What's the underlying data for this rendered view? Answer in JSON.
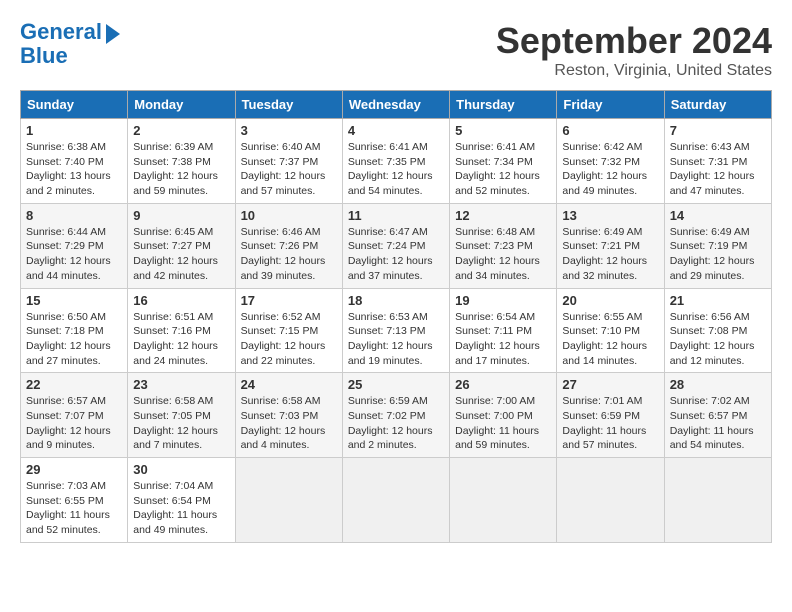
{
  "header": {
    "logo_line1": "General",
    "logo_line2": "Blue",
    "title": "September 2024",
    "subtitle": "Reston, Virginia, United States"
  },
  "weekdays": [
    "Sunday",
    "Monday",
    "Tuesday",
    "Wednesday",
    "Thursday",
    "Friday",
    "Saturday"
  ],
  "weeks": [
    [
      {
        "day": "1",
        "sunrise": "6:38 AM",
        "sunset": "7:40 PM",
        "daylight": "13 hours and 2 minutes."
      },
      {
        "day": "2",
        "sunrise": "6:39 AM",
        "sunset": "7:38 PM",
        "daylight": "12 hours and 59 minutes."
      },
      {
        "day": "3",
        "sunrise": "6:40 AM",
        "sunset": "7:37 PM",
        "daylight": "12 hours and 57 minutes."
      },
      {
        "day": "4",
        "sunrise": "6:41 AM",
        "sunset": "7:35 PM",
        "daylight": "12 hours and 54 minutes."
      },
      {
        "day": "5",
        "sunrise": "6:41 AM",
        "sunset": "7:34 PM",
        "daylight": "12 hours and 52 minutes."
      },
      {
        "day": "6",
        "sunrise": "6:42 AM",
        "sunset": "7:32 PM",
        "daylight": "12 hours and 49 minutes."
      },
      {
        "day": "7",
        "sunrise": "6:43 AM",
        "sunset": "7:31 PM",
        "daylight": "12 hours and 47 minutes."
      }
    ],
    [
      {
        "day": "8",
        "sunrise": "6:44 AM",
        "sunset": "7:29 PM",
        "daylight": "12 hours and 44 minutes."
      },
      {
        "day": "9",
        "sunrise": "6:45 AM",
        "sunset": "7:27 PM",
        "daylight": "12 hours and 42 minutes."
      },
      {
        "day": "10",
        "sunrise": "6:46 AM",
        "sunset": "7:26 PM",
        "daylight": "12 hours and 39 minutes."
      },
      {
        "day": "11",
        "sunrise": "6:47 AM",
        "sunset": "7:24 PM",
        "daylight": "12 hours and 37 minutes."
      },
      {
        "day": "12",
        "sunrise": "6:48 AM",
        "sunset": "7:23 PM",
        "daylight": "12 hours and 34 minutes."
      },
      {
        "day": "13",
        "sunrise": "6:49 AM",
        "sunset": "7:21 PM",
        "daylight": "12 hours and 32 minutes."
      },
      {
        "day": "14",
        "sunrise": "6:49 AM",
        "sunset": "7:19 PM",
        "daylight": "12 hours and 29 minutes."
      }
    ],
    [
      {
        "day": "15",
        "sunrise": "6:50 AM",
        "sunset": "7:18 PM",
        "daylight": "12 hours and 27 minutes."
      },
      {
        "day": "16",
        "sunrise": "6:51 AM",
        "sunset": "7:16 PM",
        "daylight": "12 hours and 24 minutes."
      },
      {
        "day": "17",
        "sunrise": "6:52 AM",
        "sunset": "7:15 PM",
        "daylight": "12 hours and 22 minutes."
      },
      {
        "day": "18",
        "sunrise": "6:53 AM",
        "sunset": "7:13 PM",
        "daylight": "12 hours and 19 minutes."
      },
      {
        "day": "19",
        "sunrise": "6:54 AM",
        "sunset": "7:11 PM",
        "daylight": "12 hours and 17 minutes."
      },
      {
        "day": "20",
        "sunrise": "6:55 AM",
        "sunset": "7:10 PM",
        "daylight": "12 hours and 14 minutes."
      },
      {
        "day": "21",
        "sunrise": "6:56 AM",
        "sunset": "7:08 PM",
        "daylight": "12 hours and 12 minutes."
      }
    ],
    [
      {
        "day": "22",
        "sunrise": "6:57 AM",
        "sunset": "7:07 PM",
        "daylight": "12 hours and 9 minutes."
      },
      {
        "day": "23",
        "sunrise": "6:58 AM",
        "sunset": "7:05 PM",
        "daylight": "12 hours and 7 minutes."
      },
      {
        "day": "24",
        "sunrise": "6:58 AM",
        "sunset": "7:03 PM",
        "daylight": "12 hours and 4 minutes."
      },
      {
        "day": "25",
        "sunrise": "6:59 AM",
        "sunset": "7:02 PM",
        "daylight": "12 hours and 2 minutes."
      },
      {
        "day": "26",
        "sunrise": "7:00 AM",
        "sunset": "7:00 PM",
        "daylight": "11 hours and 59 minutes."
      },
      {
        "day": "27",
        "sunrise": "7:01 AM",
        "sunset": "6:59 PM",
        "daylight": "11 hours and 57 minutes."
      },
      {
        "day": "28",
        "sunrise": "7:02 AM",
        "sunset": "6:57 PM",
        "daylight": "11 hours and 54 minutes."
      }
    ],
    [
      {
        "day": "29",
        "sunrise": "7:03 AM",
        "sunset": "6:55 PM",
        "daylight": "11 hours and 52 minutes."
      },
      {
        "day": "30",
        "sunrise": "7:04 AM",
        "sunset": "6:54 PM",
        "daylight": "11 hours and 49 minutes."
      },
      null,
      null,
      null,
      null,
      null
    ]
  ]
}
